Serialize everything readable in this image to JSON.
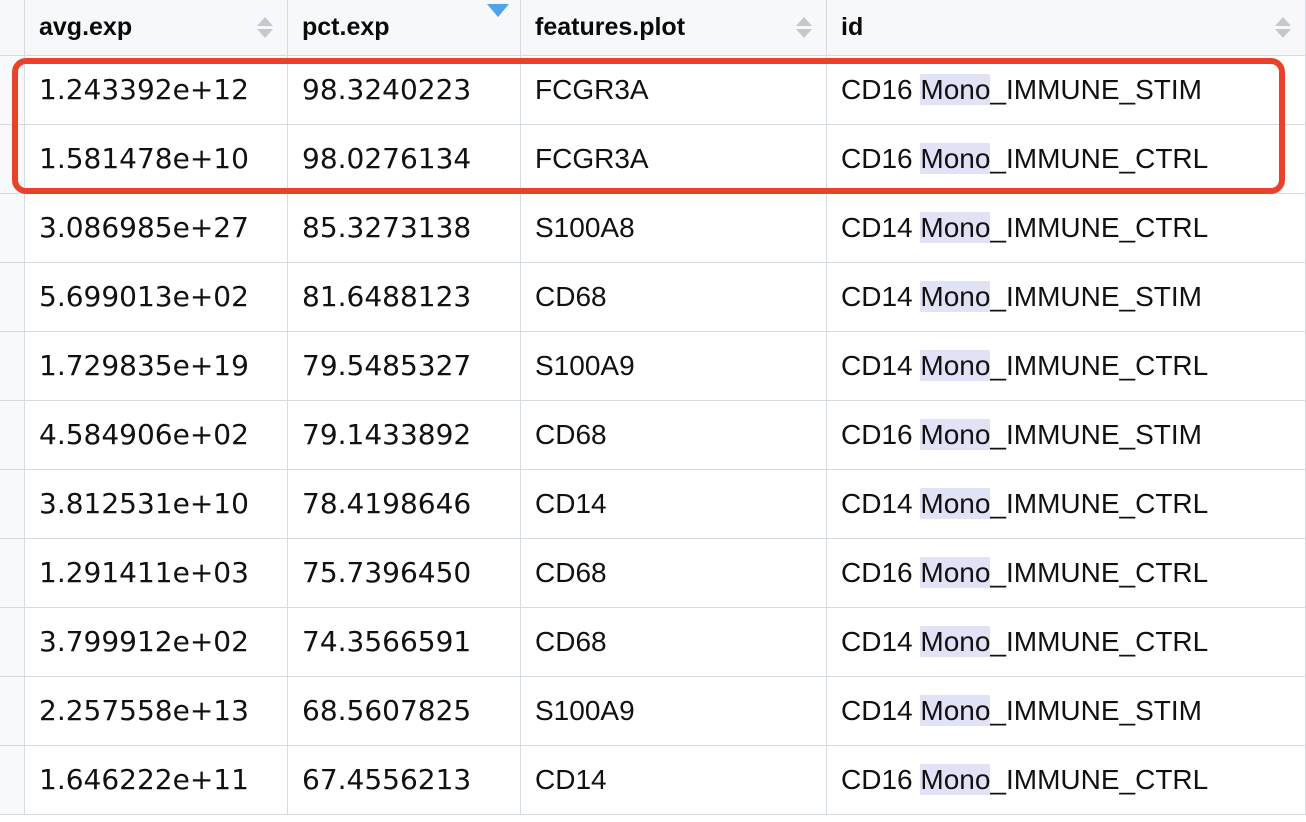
{
  "table": {
    "columns": [
      {
        "key": "avg_exp",
        "label": "avg.exp",
        "sort": "none",
        "icon": "sort-both-icon"
      },
      {
        "key": "pct_exp",
        "label": "pct.exp",
        "sort": "desc",
        "icon": "sort-desc-icon"
      },
      {
        "key": "features_plot",
        "label": "features.plot",
        "sort": "none",
        "icon": "sort-both-icon"
      },
      {
        "key": "id",
        "label": "id",
        "sort": "none",
        "icon": "sort-both-icon"
      }
    ],
    "highlight_term": "Mono",
    "rows": [
      {
        "avg_exp": "1.243392e+12",
        "pct_exp": "98.3240223",
        "features_plot": "FCGR3A",
        "id_prefix": "CD16 ",
        "id_match": "Mono",
        "id_suffix": "_IMMUNE_STIM",
        "id": "CD16 Mono_IMMUNE_STIM",
        "annotated": true
      },
      {
        "avg_exp": "1.581478e+10",
        "pct_exp": "98.0276134",
        "features_plot": "FCGR3A",
        "id_prefix": "CD16 ",
        "id_match": "Mono",
        "id_suffix": "_IMMUNE_CTRL",
        "id": "CD16 Mono_IMMUNE_CTRL",
        "annotated": true
      },
      {
        "avg_exp": "3.086985e+27",
        "pct_exp": "85.3273138",
        "features_plot": "S100A8",
        "id_prefix": "CD14 ",
        "id_match": "Mono",
        "id_suffix": "_IMMUNE_CTRL",
        "id": "CD14 Mono_IMMUNE_CTRL",
        "annotated": false
      },
      {
        "avg_exp": "5.699013e+02",
        "pct_exp": "81.6488123",
        "features_plot": "CD68",
        "id_prefix": "CD14 ",
        "id_match": "Mono",
        "id_suffix": "_IMMUNE_STIM",
        "id": "CD14 Mono_IMMUNE_STIM",
        "annotated": false
      },
      {
        "avg_exp": "1.729835e+19",
        "pct_exp": "79.5485327",
        "features_plot": "S100A9",
        "id_prefix": "CD14 ",
        "id_match": "Mono",
        "id_suffix": "_IMMUNE_CTRL",
        "id": "CD14 Mono_IMMUNE_CTRL",
        "annotated": false
      },
      {
        "avg_exp": "4.584906e+02",
        "pct_exp": "79.1433892",
        "features_plot": "CD68",
        "id_prefix": "CD16 ",
        "id_match": "Mono",
        "id_suffix": "_IMMUNE_STIM",
        "id": "CD16 Mono_IMMUNE_STIM",
        "annotated": false
      },
      {
        "avg_exp": "3.812531e+10",
        "pct_exp": "78.4198646",
        "features_plot": "CD14",
        "id_prefix": "CD14 ",
        "id_match": "Mono",
        "id_suffix": "_IMMUNE_CTRL",
        "id": "CD14 Mono_IMMUNE_CTRL",
        "annotated": false
      },
      {
        "avg_exp": "1.291411e+03",
        "pct_exp": "75.7396450",
        "features_plot": "CD68",
        "id_prefix": "CD16 ",
        "id_match": "Mono",
        "id_suffix": "_IMMUNE_CTRL",
        "id": "CD16 Mono_IMMUNE_CTRL",
        "annotated": false
      },
      {
        "avg_exp": "3.799912e+02",
        "pct_exp": "74.3566591",
        "features_plot": "CD68",
        "id_prefix": "CD14 ",
        "id_match": "Mono",
        "id_suffix": "_IMMUNE_CTRL",
        "id": "CD14 Mono_IMMUNE_CTRL",
        "annotated": false
      },
      {
        "avg_exp": "2.257558e+13",
        "pct_exp": "68.5607825",
        "features_plot": "S100A9",
        "id_prefix": "CD14 ",
        "id_match": "Mono",
        "id_suffix": "_IMMUNE_STIM",
        "id": "CD14 Mono_IMMUNE_STIM",
        "annotated": false
      },
      {
        "avg_exp": "1.646222e+11",
        "pct_exp": "67.4556213",
        "features_plot": "CD14",
        "id_prefix": "CD16 ",
        "id_match": "Mono",
        "id_suffix": "_IMMUNE_CTRL",
        "id": "CD16 Mono_IMMUNE_CTRL",
        "annotated": false
      }
    ]
  },
  "annotation": {
    "type": "rounded-rectangle-highlight",
    "color": "#e8432a",
    "covers_rows": [
      0,
      1
    ]
  },
  "colors": {
    "header_bg": "#f6f8fa",
    "grid_line": "#d5dbe0",
    "row_bg": "#ffffff",
    "text": "#111111",
    "sort_inactive": "#c3c9ce",
    "sort_active": "#50a3e8",
    "match_highlight": "#e2e2f7",
    "annotation": "#e8432a"
  }
}
